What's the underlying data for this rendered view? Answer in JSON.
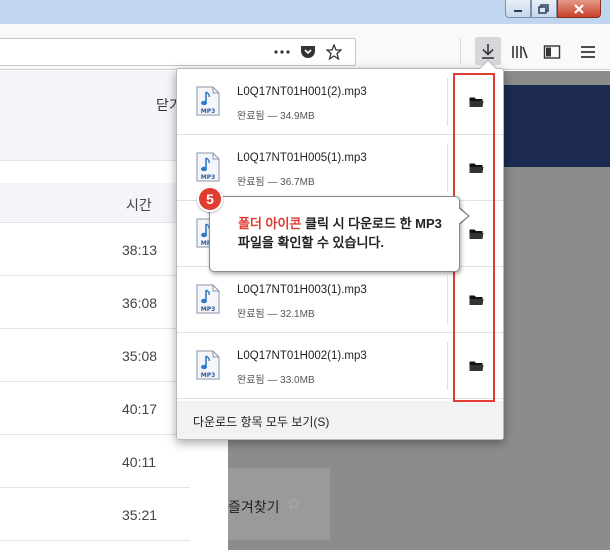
{
  "background_page": {
    "close_label": "닫기",
    "column_time": "시간",
    "times": [
      "38:13",
      "36:08",
      "35:08",
      "40:17",
      "40:11",
      "35:21"
    ],
    "favorite_label": "즐겨찾기",
    "favorite_icon": "star-icon"
  },
  "downloads_panel": {
    "items": [
      {
        "name": "L0Q17NT01H001(2).mp3",
        "status": "완료됨 — 34.9MB"
      },
      {
        "name": "L0Q17NT01H005(1).mp3",
        "status": "완료됨 — 36.7MB"
      },
      {
        "name": "",
        "status": ""
      },
      {
        "name": "L0Q17NT01H003(1).mp3",
        "status": "완료됨 — 32.1MB"
      },
      {
        "name": "L0Q17NT01H002(1).mp3",
        "status": "완료됨 — 33.0MB"
      }
    ],
    "show_all_label": "다운로드 항목 모두 보기(S)"
  },
  "annotation": {
    "step": "5",
    "highlight": "폴더 아이콘",
    "text_rest": " 클릭 시 다운로드 한 MP3파일을 확인할 수 있습니다.",
    "accent_color": "#e03c32"
  },
  "colors": {
    "navy": "#1c2a52",
    "overlay_gray": "#8c8c8c"
  }
}
